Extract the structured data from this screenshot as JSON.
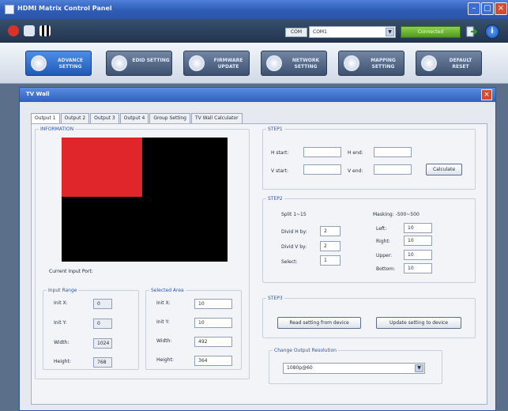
{
  "app": {
    "title": "HDMI Matrix Control Panel",
    "com_label": "COM",
    "com_port": "COM1",
    "connect_label": "Connected",
    "info_glyph": "i"
  },
  "nav": [
    {
      "label": "ADVANCE SETTING",
      "active": true
    },
    {
      "label": "EDID SETTING",
      "active": false
    },
    {
      "label": "FIRMWARE UPDATE",
      "active": false
    },
    {
      "label": "NETWORK SETTING",
      "active": false
    },
    {
      "label": "MAPPING SETTING",
      "active": false
    },
    {
      "label": "DEFAULT RESET",
      "active": false
    }
  ],
  "dialog": {
    "title": "TV Wall",
    "tabs": [
      "Output 1",
      "Output 2",
      "Output 3",
      "Output 4",
      "Group Setting",
      "TV Wall Calculator"
    ],
    "active_tab": 0
  },
  "information": {
    "legend": "INFORMATION",
    "current_input_port_label": "Current Input Port:"
  },
  "input_range": {
    "legend": "Input Range",
    "init_x_label": "Init X:",
    "init_x": "0",
    "init_y_label": "Init Y:",
    "init_y": "0",
    "width_label": "Width:",
    "width": "1024",
    "height_label": "Height:",
    "height": "768"
  },
  "selected_area": {
    "legend": "Selected Area",
    "init_x_label": "Init X:",
    "init_x": "10",
    "init_y_label": "Init Y:",
    "init_y": "10",
    "width_label": "Width:",
    "width": "492",
    "height_label": "Height:",
    "height": "364"
  },
  "step1": {
    "legend": "STEP1",
    "h_start_label": "H start:",
    "h_start": "",
    "h_end_label": "H end:",
    "h_end": "",
    "v_start_label": "V start:",
    "v_start": "",
    "v_end_label": "V end:",
    "v_end": "",
    "calculate_label": "Calculate"
  },
  "step2": {
    "legend": "STEP2",
    "split_label": "Split 1~15",
    "divid_h_label": "Divid H by:",
    "divid_h": "2",
    "divid_v_label": "Divid V by:",
    "divid_v": "2",
    "select_label": "Select:",
    "select": "1",
    "masking_label": "Masking: -500~500",
    "left_label": "Left:",
    "left": "10",
    "right_label": "Right:",
    "right": "10",
    "upper_label": "Upper:",
    "upper": "10",
    "bottom_label": "Bottom:",
    "bottom": "10"
  },
  "step3": {
    "legend": "STEP3",
    "read_label": "Read setting from device",
    "update_label": "Update setting to device"
  },
  "output_resolution": {
    "legend": "Change Output Resolution",
    "value": "1080p@60"
  },
  "colors": {
    "titlebar": "#2e5cb6",
    "preview_bg": "#000000",
    "preview_area": "#e1262b",
    "legend_text": "#2b55b5",
    "connect": "#4f9a1f"
  }
}
